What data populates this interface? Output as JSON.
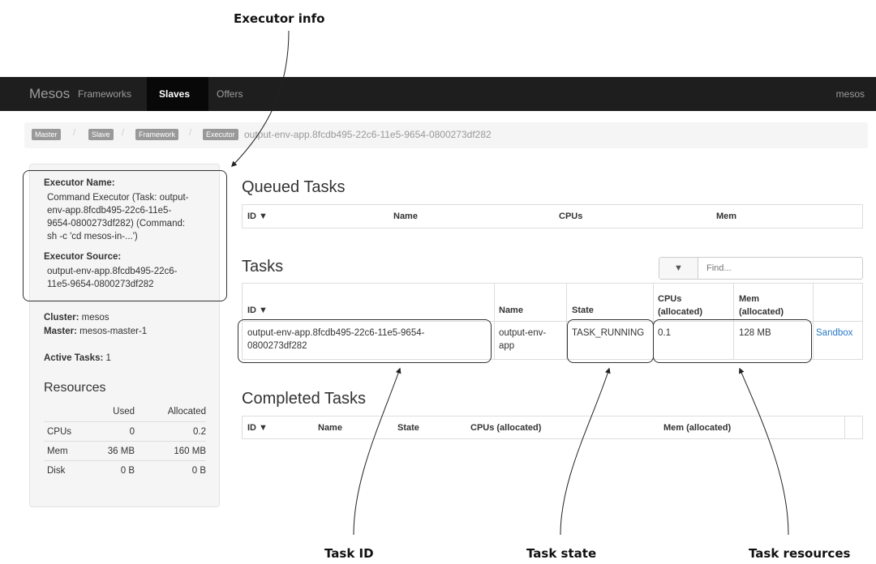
{
  "callouts": {
    "executor_info": "Executor info",
    "task_id": "Task ID",
    "task_state": "Task state",
    "task_resources": "Task resources"
  },
  "navbar": {
    "brand": "Mesos",
    "items": [
      {
        "label": "Frameworks",
        "active": false
      },
      {
        "label": "Slaves",
        "active": true
      },
      {
        "label": "Offers",
        "active": false
      }
    ],
    "user": "mesos"
  },
  "breadcrumb": {
    "items": [
      "Master",
      "Slave",
      "Framework",
      "Executor"
    ],
    "separator": "/",
    "current": "output-env-app.8fcdb495-22c6-11e5-9654-0800273df282"
  },
  "sidebar": {
    "executor_name_label": "Executor Name:",
    "executor_name_lines": [
      "Command Executor (Task: output-",
      "env-app.8fcdb495-22c6-11e5-",
      "9654-0800273df282) (Command:",
      "sh -c 'cd mesos-in-...')"
    ],
    "executor_source_label": "Executor Source:",
    "executor_source_lines": [
      "output-env-app.8fcdb495-22c6-",
      "11e5-9654-0800273df282"
    ],
    "cluster_label": "Cluster:",
    "cluster_value": "mesos",
    "master_label": "Master:",
    "master_value": "mesos-master-1",
    "active_tasks_label": "Active Tasks:",
    "active_tasks_value": "1",
    "resources_title": "Resources",
    "resources_headers": [
      "Used",
      "Allocated"
    ],
    "resources_rows": [
      {
        "name": "CPUs",
        "used": "0",
        "allocated": "0.2"
      },
      {
        "name": "Mem",
        "used": "36 MB",
        "allocated": "160 MB"
      },
      {
        "name": "Disk",
        "used": "0 B",
        "allocated": "0 B"
      }
    ]
  },
  "queued": {
    "title": "Queued Tasks",
    "headers": [
      "ID ▼",
      "Name",
      "CPUs",
      "Mem"
    ]
  },
  "tasks": {
    "title": "Tasks",
    "filter_icon": "filter-icon",
    "find_placeholder": "Find...",
    "headers": {
      "id": "ID ▼",
      "name": "Name",
      "state": "State",
      "cpus_1": "CPUs",
      "cpus_2": "(allocated)",
      "mem_1": "Mem",
      "mem_2": "(allocated)"
    },
    "row": {
      "id_lines": [
        "output-env-app.8fcdb495-22c6-11e5-9654-",
        "0800273df282"
      ],
      "name_lines": [
        "output-env-",
        "app"
      ],
      "state": "TASK_RUNNING",
      "cpus": "0.1",
      "mem": "128 MB",
      "link": "Sandbox"
    }
  },
  "completed": {
    "title": "Completed Tasks",
    "headers": [
      "ID ▼",
      "Name",
      "State",
      "CPUs (allocated)",
      "Mem (allocated)"
    ]
  },
  "colors": {
    "navbar_bg": "#1e1e1e",
    "link": "#2a7ac4",
    "annotation": "#333333"
  }
}
